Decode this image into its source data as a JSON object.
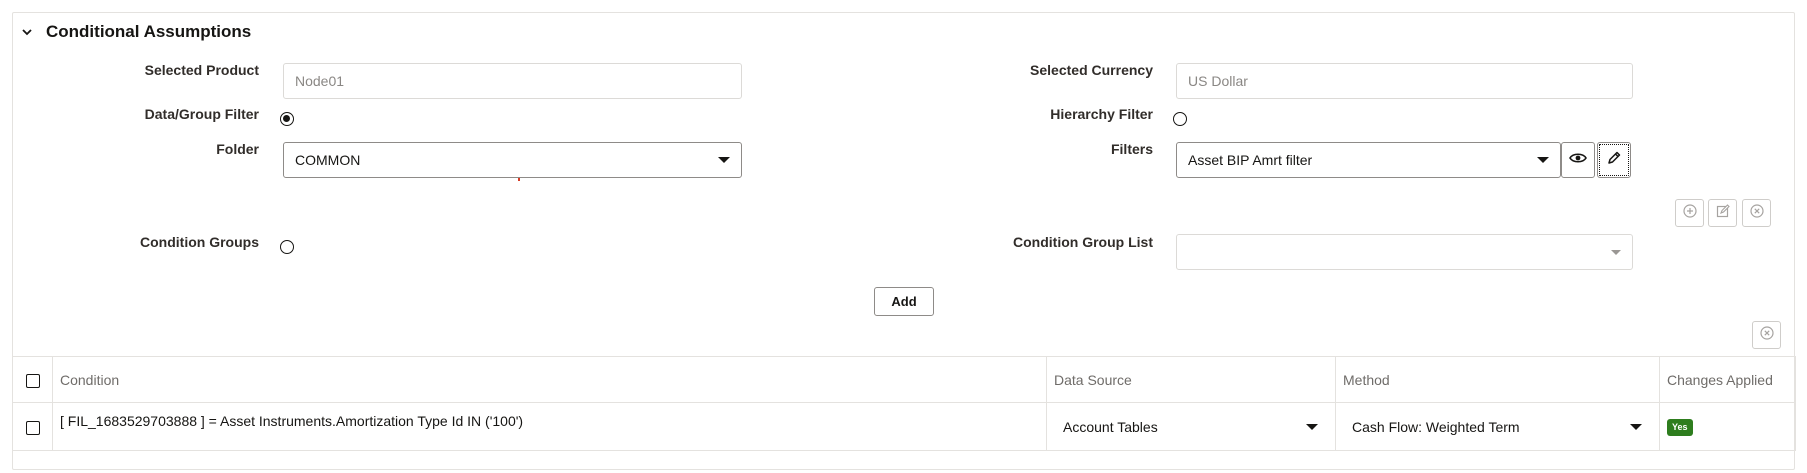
{
  "section": {
    "title": "Conditional Assumptions"
  },
  "form": {
    "selected_product": {
      "label": "Selected Product",
      "value": "Node01"
    },
    "selected_currency": {
      "label": "Selected Currency",
      "value": "US Dollar"
    },
    "data_group_filter": {
      "label": "Data/Group Filter",
      "checked": true
    },
    "hierarchy_filter": {
      "label": "Hierarchy Filter",
      "checked": false
    },
    "folder": {
      "label": "Folder",
      "value": "COMMON"
    },
    "filters": {
      "label": "Filters",
      "value": "Asset BIP Amrt filter"
    },
    "condition_groups": {
      "label": "Condition Groups",
      "checked": false
    },
    "condition_group_list": {
      "label": "Condition Group List",
      "value": ""
    },
    "add_label": "Add"
  },
  "table": {
    "columns": [
      "Condition",
      "Data Source",
      "Method",
      "Changes Applied"
    ],
    "rows": [
      {
        "condition": "[ FIL_1683529703888 ] = Asset Instruments.Amortization Type Id IN ('100')",
        "data_source": "Account Tables",
        "method": "Cash Flow: Weighted Term",
        "changes_applied": "Yes"
      }
    ]
  },
  "icons": {
    "collapse": "chevron-down-icon",
    "view": "eye-icon",
    "edit": "pencil-icon",
    "add": "plus-circle-icon",
    "edit_group": "edit-square-icon",
    "remove": "close-circle-icon"
  },
  "colors": {
    "accent_green": "#2e7d1e",
    "border": "#e4e2df",
    "text": "#161513"
  }
}
